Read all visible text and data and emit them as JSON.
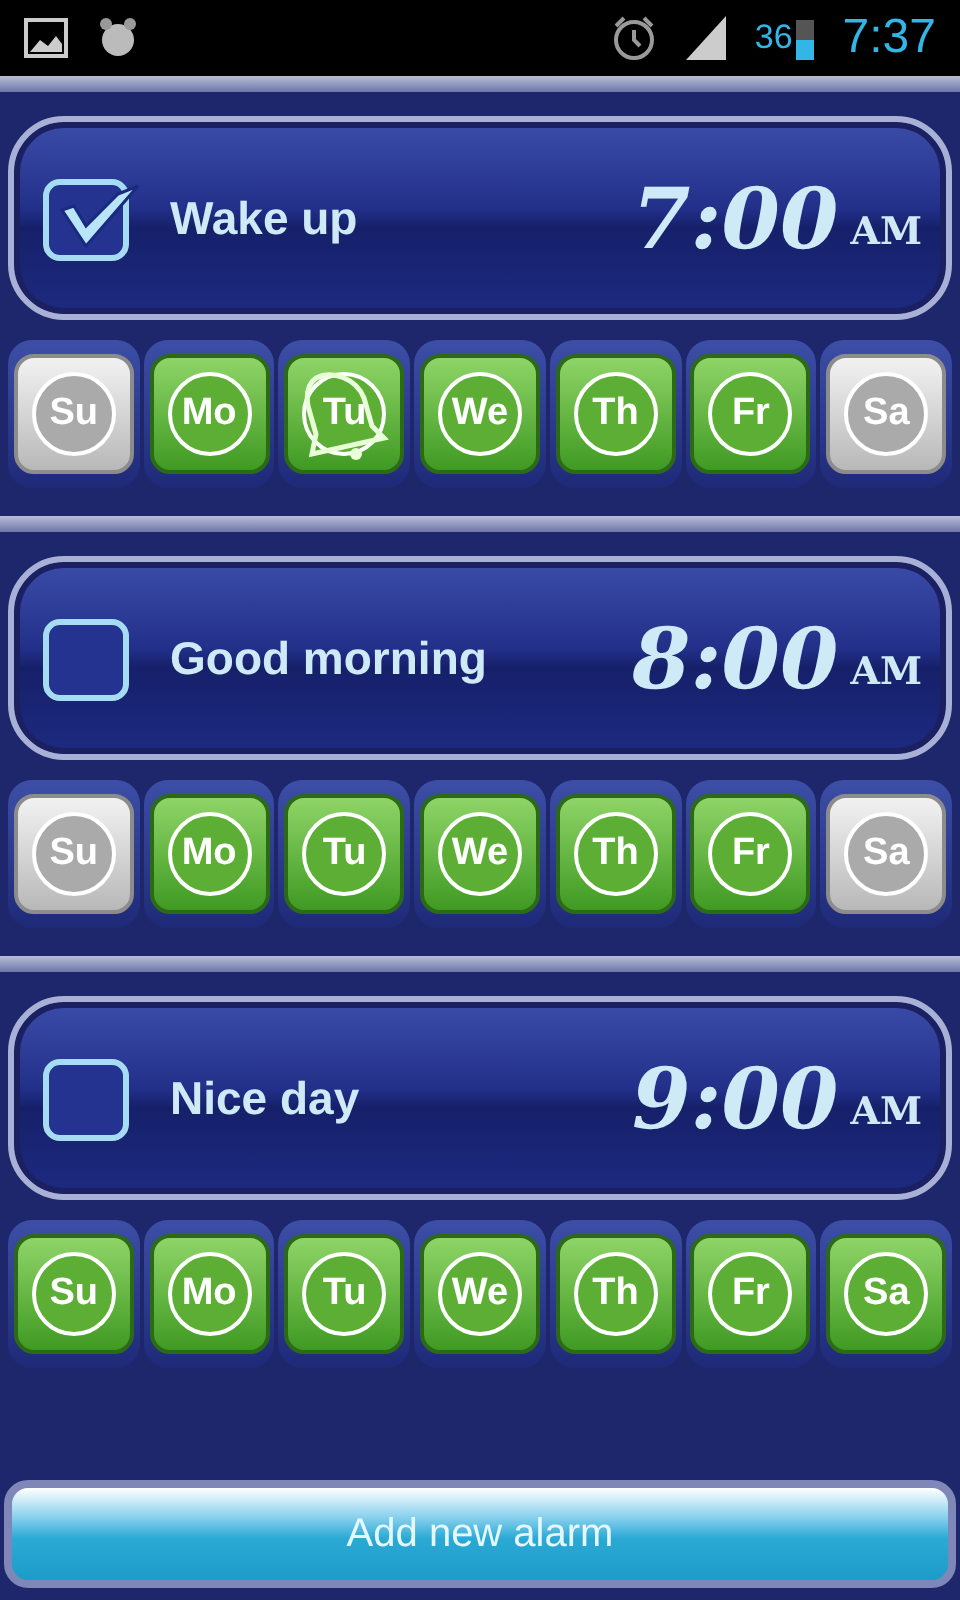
{
  "status_bar": {
    "battery": "36",
    "time": "7:37"
  },
  "alarms": [
    {
      "label": "Wake up",
      "enabled": true,
      "time": "7:00",
      "period": "AM",
      "days": [
        {
          "label": "Su",
          "on": false,
          "today": false
        },
        {
          "label": "Mo",
          "on": true,
          "today": false
        },
        {
          "label": "Tu",
          "on": true,
          "today": true
        },
        {
          "label": "We",
          "on": true,
          "today": false
        },
        {
          "label": "Th",
          "on": true,
          "today": false
        },
        {
          "label": "Fr",
          "on": true,
          "today": false
        },
        {
          "label": "Sa",
          "on": false,
          "today": false
        }
      ]
    },
    {
      "label": "Good morning",
      "enabled": false,
      "time": "8:00",
      "period": "AM",
      "days": [
        {
          "label": "Su",
          "on": false,
          "today": false
        },
        {
          "label": "Mo",
          "on": true,
          "today": false
        },
        {
          "label": "Tu",
          "on": true,
          "today": false
        },
        {
          "label": "We",
          "on": true,
          "today": false
        },
        {
          "label": "Th",
          "on": true,
          "today": false
        },
        {
          "label": "Fr",
          "on": true,
          "today": false
        },
        {
          "label": "Sa",
          "on": false,
          "today": false
        }
      ]
    },
    {
      "label": "Nice day",
      "enabled": false,
      "time": "9:00",
      "period": "AM",
      "days": [
        {
          "label": "Su",
          "on": true,
          "today": false
        },
        {
          "label": "Mo",
          "on": true,
          "today": false
        },
        {
          "label": "Tu",
          "on": true,
          "today": false
        },
        {
          "label": "We",
          "on": true,
          "today": false
        },
        {
          "label": "Th",
          "on": true,
          "today": false
        },
        {
          "label": "Fr",
          "on": true,
          "today": false
        },
        {
          "label": "Sa",
          "on": true,
          "today": false
        }
      ]
    }
  ],
  "add_button": "Add new alarm"
}
